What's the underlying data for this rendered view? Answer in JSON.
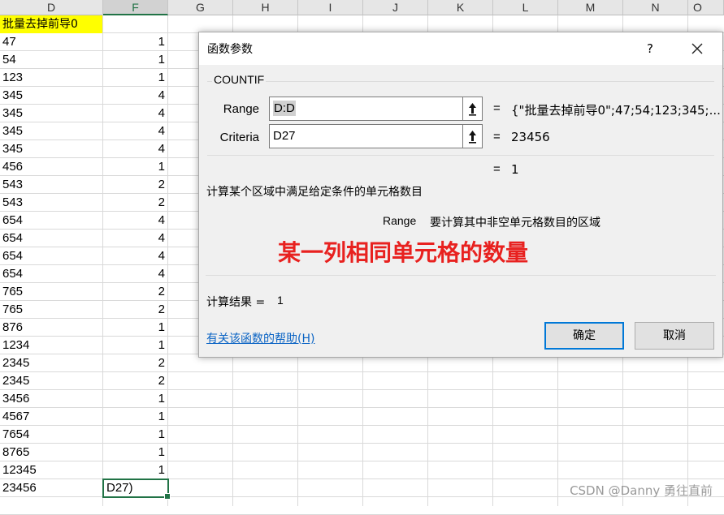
{
  "sheet": {
    "columns": [
      "D",
      "F",
      "G",
      "H",
      "I",
      "J",
      "K",
      "L",
      "M",
      "N",
      "O"
    ],
    "header_cell": "批量去掉前导0",
    "rows": [
      {
        "d": "47",
        "f": "1"
      },
      {
        "d": "54",
        "f": "1"
      },
      {
        "d": "123",
        "f": "1"
      },
      {
        "d": "345",
        "f": "4"
      },
      {
        "d": "345",
        "f": "4"
      },
      {
        "d": "345",
        "f": "4"
      },
      {
        "d": "345",
        "f": "4"
      },
      {
        "d": "456",
        "f": "1"
      },
      {
        "d": "543",
        "f": "2"
      },
      {
        "d": "543",
        "f": "2"
      },
      {
        "d": "654",
        "f": "4"
      },
      {
        "d": "654",
        "f": "4"
      },
      {
        "d": "654",
        "f": "4"
      },
      {
        "d": "654",
        "f": "4"
      },
      {
        "d": "765",
        "f": "2"
      },
      {
        "d": "765",
        "f": "2"
      },
      {
        "d": "876",
        "f": "1"
      },
      {
        "d": "1234",
        "f": "1"
      },
      {
        "d": "2345",
        "f": "2"
      },
      {
        "d": "2345",
        "f": "2"
      },
      {
        "d": "3456",
        "f": "1"
      },
      {
        "d": "4567",
        "f": "1"
      },
      {
        "d": "7654",
        "f": "1"
      },
      {
        "d": "8765",
        "f": "1"
      },
      {
        "d": "12345",
        "f": "1"
      }
    ],
    "last_row_d": "23456",
    "active_cell_text": "D27)",
    "accent_color": "#217346",
    "highlight_color": "#ffff00"
  },
  "dialog": {
    "title": "函数参数",
    "help_button": "?",
    "function_name": "COUNTIF",
    "args": [
      {
        "label": "Range",
        "value": "D:D",
        "result": "{\"批量去掉前导0\";47;54;123;345;..."
      },
      {
        "label": "Criteria",
        "value": "D27",
        "result": "23456"
      }
    ],
    "formula_result": "1",
    "description": "计算某个区域中满足给定条件的单元格数目",
    "arg_help_name": "Range",
    "arg_help_text": "要计算其中非空单元格数目的区域",
    "annotation": "某一列相同单元格的数量",
    "annotation_color": "#e8211f",
    "result_label": "计算结果 =",
    "result_value": "1",
    "help_link": "有关该函数的帮助(H)",
    "ok_label": "确定",
    "cancel_label": "取消",
    "equals": "="
  },
  "watermark": "CSDN @Danny 勇往直前"
}
